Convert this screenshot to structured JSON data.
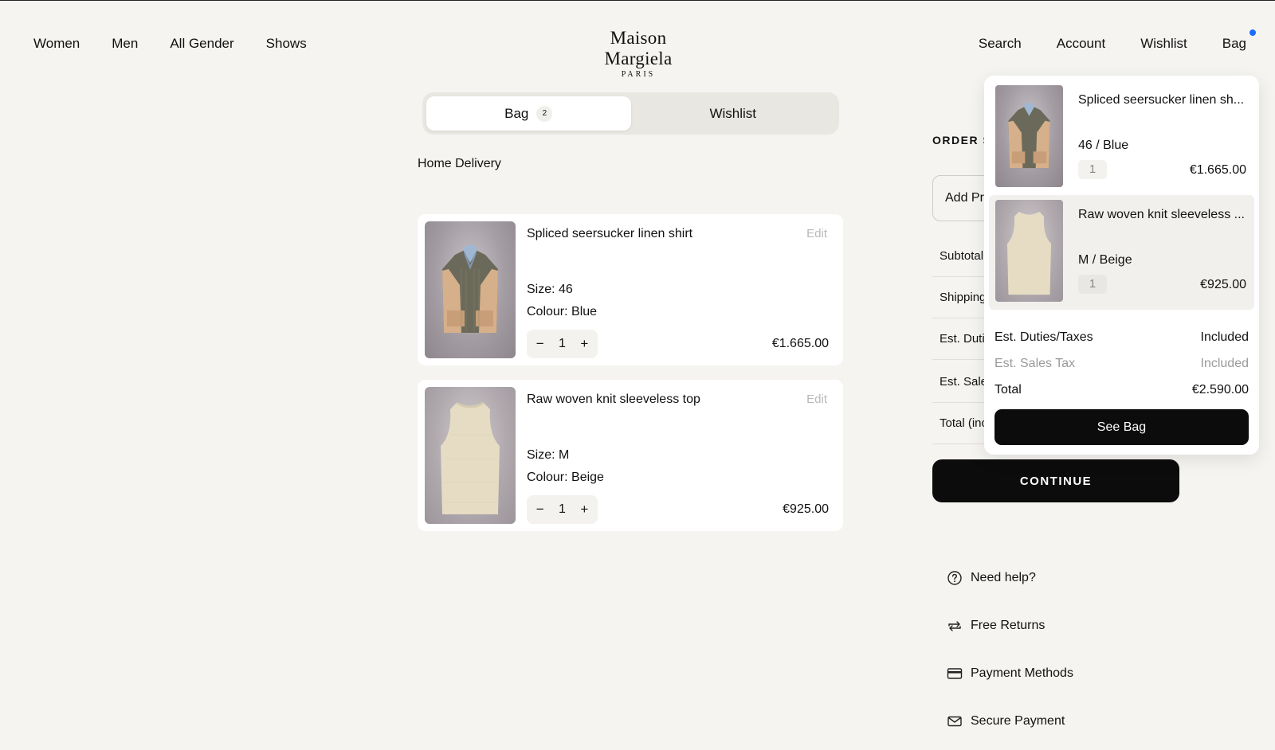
{
  "nav": {
    "left": [
      "Women",
      "Men",
      "All Gender",
      "Shows"
    ],
    "right": [
      "Search",
      "Account",
      "Wishlist",
      "Bag"
    ],
    "bag_indicator_color": "#1c6dff"
  },
  "logo": {
    "main": "Maison Margiela",
    "sub": "PARIS"
  },
  "tabs": {
    "bag_label": "Bag",
    "bag_count": "2",
    "wishlist_label": "Wishlist"
  },
  "delivery": {
    "title": "Home Delivery"
  },
  "cart": {
    "edit_label": "Edit",
    "items": [
      {
        "name": "Spliced seersucker linen shirt",
        "size": "Size: 46",
        "colour": "Colour: Blue",
        "qty": "1",
        "price": "€1.665.00"
      },
      {
        "name": "Raw woven knit sleeveless top",
        "size": "Size: M",
        "colour": "Colour: Beige",
        "qty": "1",
        "price": "€925.00"
      }
    ]
  },
  "summary": {
    "title": "ORDER SUMMARY",
    "promo": "Add Promo Code",
    "rows": [
      "Subtotal",
      "Shipping",
      "Est. Duties/Taxes",
      "Est. Sales Tax",
      "Total (incl. taxes)"
    ],
    "continue_label": "CONTINUE"
  },
  "help": {
    "items": [
      {
        "label": "Need help?",
        "icon": "question-circle-icon"
      },
      {
        "label": "Free Returns",
        "icon": "return-arrows-icon"
      },
      {
        "label": "Payment Methods",
        "icon": "credit-card-icon"
      },
      {
        "label": "Secure Payment",
        "icon": "envelope-icon"
      }
    ]
  },
  "dropdown": {
    "items": [
      {
        "name": "Spliced seersucker linen sh...",
        "variant": "46  /  Blue",
        "qty": "1",
        "price": "€1.665.00"
      },
      {
        "name": "Raw woven knit sleeveless ...",
        "variant": "M  /  Beige",
        "qty": "1",
        "price": "€925.00"
      }
    ],
    "duties_label": "Est. Duties/Taxes",
    "duties_value": "Included",
    "sales_tax_label": "Est. Sales Tax",
    "sales_tax_value": "Included",
    "total_label": "Total",
    "total_value": "€2.590.00",
    "see_bag_label": "See Bag"
  }
}
